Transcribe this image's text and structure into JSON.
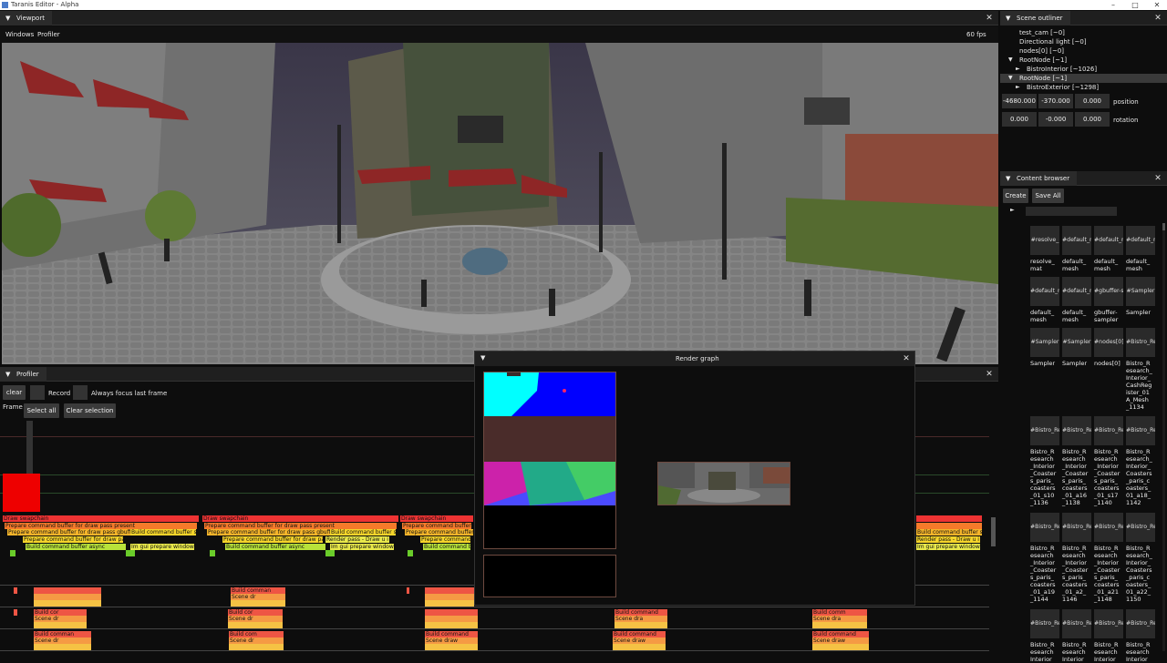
{
  "window": {
    "title": "Taranis Editor - Alpha",
    "controls": [
      "–",
      "□",
      "✕"
    ]
  },
  "viewport": {
    "tab_label": "Viewport",
    "menu": [
      "Windows",
      "Profiler"
    ],
    "fps": "60 fps"
  },
  "outliner": {
    "tab_label": "Scene outliner",
    "items": [
      {
        "label": "test_cam [~0]",
        "indent": 0,
        "arrow": ""
      },
      {
        "label": "Directional light [~0]",
        "indent": 0,
        "arrow": ""
      },
      {
        "label": "nodes[0] [~0]",
        "indent": 0,
        "arrow": ""
      },
      {
        "label": "RootNode [~1]",
        "indent": 0,
        "arrow": "▼"
      },
      {
        "label": "BistroInterior [~1026]",
        "indent": 1,
        "arrow": "►"
      },
      {
        "label": "RootNode [~1]",
        "indent": 0,
        "arrow": "▼"
      },
      {
        "label": "BistroExterior [~1298]",
        "indent": 1,
        "arrow": "►"
      }
    ],
    "position": {
      "x": "-4680.000",
      "y": "-370.000",
      "z": "0.000",
      "label": "position"
    },
    "rotation": {
      "x": "0.000",
      "y": "-0.000",
      "z": "0.000",
      "label": "rotation"
    }
  },
  "content_browser": {
    "tab_label": "Content browser",
    "create_label": "Create",
    "save_all_label": "Save All",
    "search_value": "",
    "assets": [
      {
        "thumb": "#resolve_",
        "name": "resolve_\nmat"
      },
      {
        "thumb": "#default_r",
        "name": "default_\nmesh"
      },
      {
        "thumb": "#default_r",
        "name": "default_\nmesh"
      },
      {
        "thumb": "#default_r",
        "name": "default_\nmesh"
      },
      {
        "thumb": "#default_r",
        "name": "default_\nmesh"
      },
      {
        "thumb": "#default_r",
        "name": "default_\nmesh"
      },
      {
        "thumb": "#gbuffer-s",
        "name": "gbuffer-\nsampler"
      },
      {
        "thumb": "#Sampler",
        "name": "Sampler"
      },
      {
        "thumb": "#Sampler",
        "name": "Sampler"
      },
      {
        "thumb": "#Sampler",
        "name": "Sampler"
      },
      {
        "thumb": "#nodes[0]",
        "name": "nodes[0]"
      },
      {
        "thumb": "#Bistro_Re",
        "name": "Bistro_R\nesearch_\nInterior_\nCashReg\nister_01\nA_Mesh\n_1134"
      },
      {
        "thumb": "#Bistro_Re",
        "name": "Bistro_R\nesearch\n_Interior\n_Coaster\ns_paris_\ncoasters\n_01_s10\n_1136"
      },
      {
        "thumb": "#Bistro_Re",
        "name": "Bistro_R\nesearch\n_Interior\n_Coaster\ns_paris_\ncoasters\n_01_a16\n_1138"
      },
      {
        "thumb": "#Bistro_Re",
        "name": "Bistro_R\nesearch\n_Interior\n_Coaster\ns_paris_\ncoasters\n_01_s17\n_1140"
      },
      {
        "thumb": "#Bistro_Re",
        "name": "Bistro_R\nesearch_\nInterior_\nCoasters\n_paris_c\noasters_\n01_a18_\n1142"
      },
      {
        "thumb": "#Bistro_Re",
        "name": "Bistro_R\nesearch\n_Interior\n_Coaster\ns_paris_\ncoasters\n_01_a19\n_1144"
      },
      {
        "thumb": "#Bistro_Re",
        "name": "Bistro_R\nesearch\n_Interior\n_Coaster\ns_paris_\ncoasters\n_01_a2_\n1146"
      },
      {
        "thumb": "#Bistro_Re",
        "name": "Bistro_R\nesearch\n_Interior\n_Coaster\ns_paris_\ncoasters\n_01_a21\n_1148"
      },
      {
        "thumb": "#Bistro_Re",
        "name": "Bistro_R\nesearch_\nInterior_\nCoasters\n_paris_c\noasters_\n01_a22_\n1150"
      },
      {
        "thumb": "#Bistro_Re",
        "name": "Bistro_R\nesearch\nInterior"
      },
      {
        "thumb": "#Bistro_Re",
        "name": "Bistro_R\nesearch\nInterior"
      },
      {
        "thumb": "#Bistro_Re",
        "name": "Bistro_R\nesearch\nInterior"
      },
      {
        "thumb": "#Bistro_Re",
        "name": "Bistro_R\nesearch\nInterior"
      }
    ]
  },
  "profiler": {
    "tab_label": "Profiler",
    "clear_label": "clear",
    "record_label": "Record",
    "always_focus_label": "Always focus last frame",
    "frame_label": "Frame",
    "select_all_label": "Select all",
    "clear_selection_label": "Clear selection",
    "main_track": {
      "frame_groups": [
        {
          "swapchain": "Draw swapchain",
          "present": "Prepare command buffer for draw pass present",
          "gbuffer": "Prepare command buffer for draw pass gbuffer",
          "draw_pass": "Prepare command buffer for draw pass",
          "async": "Build command buffer async",
          "build_s": "Build command buffer s",
          "imgui": "Im gui prepare window"
        },
        {
          "swapchain": "Draw swapchain",
          "present": "Prepare command buffer for draw pass present",
          "gbuffer": "Prepare command buffer for draw pass gbuffer",
          "draw_pass": "Prepare command buffer for draw pass",
          "async": "Build command buffer async",
          "build_s": "Build command buffer sy",
          "render": "Render pass - Draw u i",
          "imgui": "Im gui prepare window"
        },
        {
          "swapchain": "Draw swapchain",
          "present": "Prepare command buffer f",
          "gbuffer": "Prepare command buffer f",
          "draw_pass": "Prepare command buffer",
          "async": "Build command buffer"
        }
      ],
      "tail": {
        "build_s": "Build command buffer sy",
        "render": "Render pass - Draw u i",
        "imgui": "Im gui prepare window"
      }
    },
    "worker_blocks": {
      "build_command": "Build command",
      "scene_draw": "Scene draw",
      "build_cor": "Build cor",
      "scene_dr": "Scene dr",
      "build_comman": "Build comman",
      "scene_dra": "Scene dra",
      "build_com": "Build com",
      "build_comm": "Build comm"
    }
  },
  "render_graph": {
    "title": "Render graph"
  }
}
